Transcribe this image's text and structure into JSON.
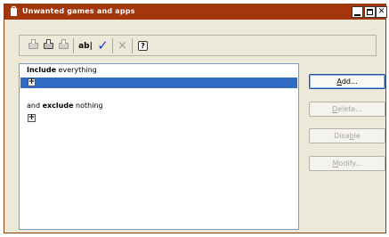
{
  "window": {
    "title": "Unwanted games and apps"
  },
  "toolbar": {
    "icons": [
      "printer-icon",
      "printer-icon",
      "printer-icon",
      "ab-edit-icon",
      "check-icon",
      "x-icon",
      "help-icon"
    ],
    "ab_label": "ab|",
    "check_glyph": "✓",
    "x_glyph": "×",
    "help_glyph": "?"
  },
  "rules": {
    "include_keyword": "Include",
    "include_rest": " everything",
    "exclude_prefix": "and ",
    "exclude_keyword": "exclude",
    "exclude_rest": " nothing",
    "expander_glyph": "+"
  },
  "buttons": {
    "add": {
      "prefix": "",
      "accel": "A",
      "suffix": "dd..."
    },
    "delete": {
      "prefix": "",
      "accel": "D",
      "suffix": "elete..."
    },
    "disable": {
      "prefix": "Disa",
      "accel": "b",
      "suffix": "le"
    },
    "modify": {
      "prefix": "",
      "accel": "M",
      "suffix": "odify..."
    }
  },
  "colors": {
    "titlebar": "#a3360b",
    "selection": "#316ac5",
    "check": "#1b3fd1"
  }
}
